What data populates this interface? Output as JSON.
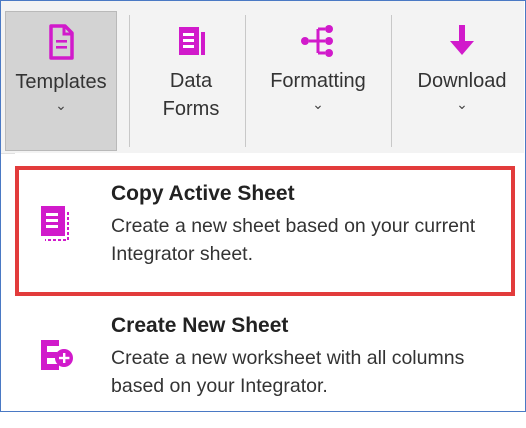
{
  "ribbon": {
    "buttons": [
      {
        "label": "Templates",
        "icon": "document-icon",
        "has_dropdown": true,
        "active": true
      },
      {
        "label": "Data Forms",
        "icon": "data-forms-icon",
        "has_dropdown": false,
        "active": false
      },
      {
        "label": "Formatting",
        "icon": "formatting-tree-icon",
        "has_dropdown": true,
        "active": false
      },
      {
        "label": "Download",
        "icon": "download-arrow-icon",
        "has_dropdown": true,
        "active": false
      }
    ],
    "chevron_glyph": "⌄"
  },
  "menu": {
    "items": [
      {
        "title": "Copy Active Sheet",
        "description": "Create a new sheet based on your current Integrator sheet.",
        "icon": "copy-sheet-icon",
        "highlighted": true
      },
      {
        "title": "Create New Sheet",
        "description": "Create a new worksheet with all columns based on your Integrator.",
        "icon": "new-sheet-icon",
        "highlighted": false
      }
    ]
  },
  "colors": {
    "accent": "#d11acb",
    "highlight_border": "#e23b3b",
    "ribbon_bg": "#f3f3f3",
    "active_button_bg": "#d3d3d3",
    "frame_border": "#4a79c4"
  }
}
